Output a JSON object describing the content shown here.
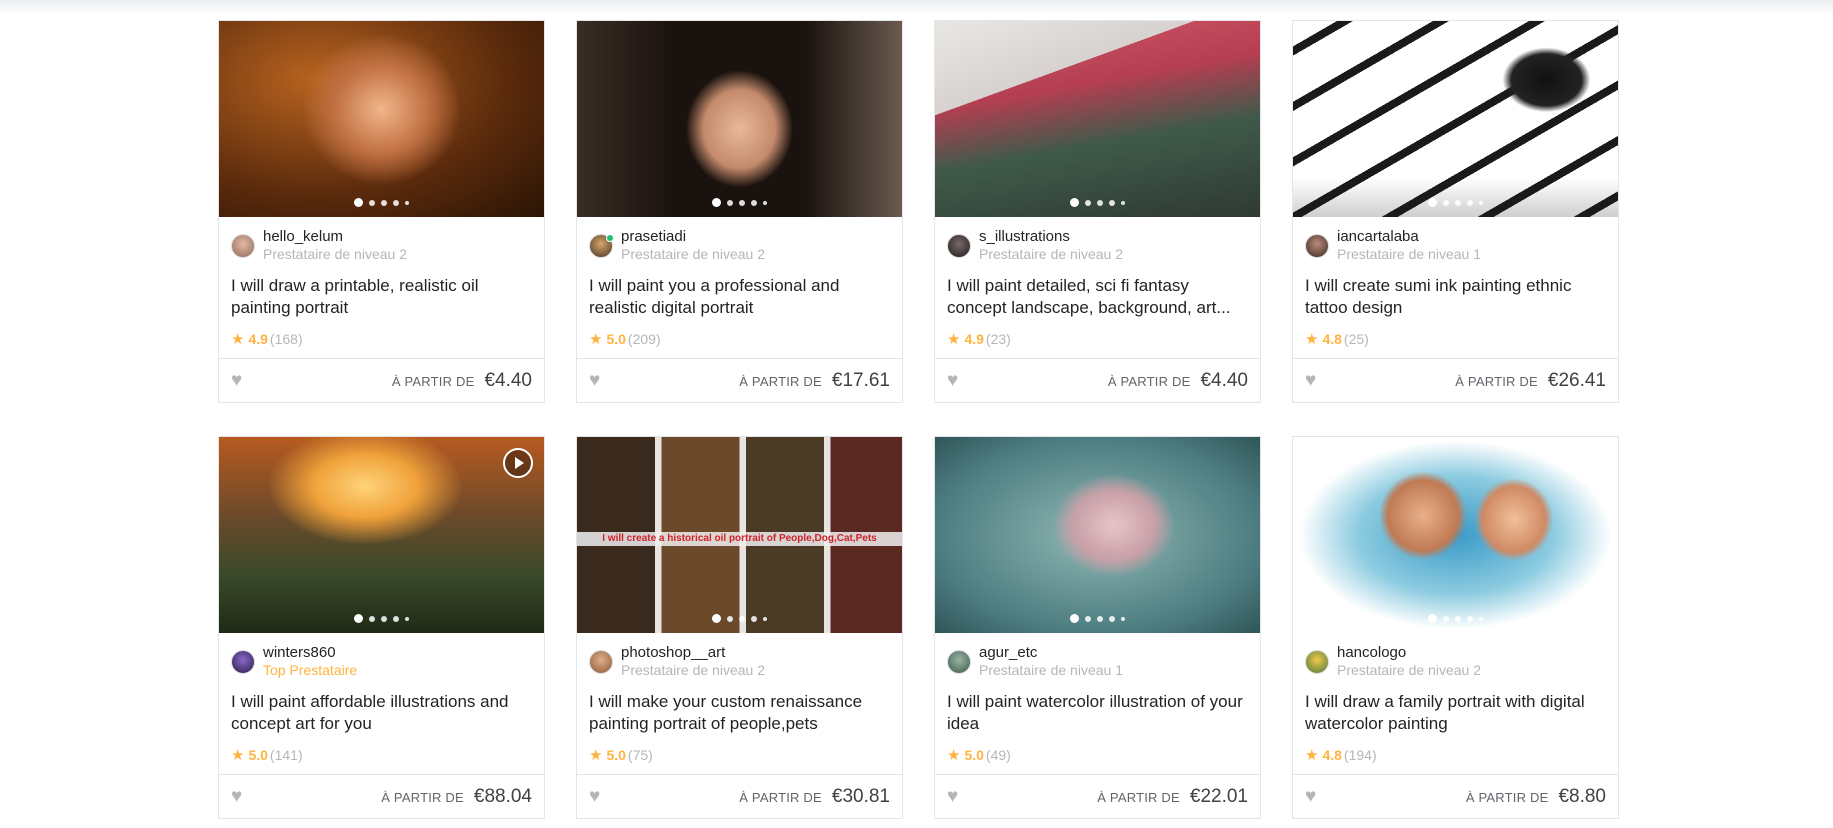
{
  "cards": [
    {
      "seller": "hello_kelum",
      "level": "Prestataire de niveau 2",
      "top": false,
      "title": "I will draw a printable, realistic oil painting portrait",
      "rating": "4.9",
      "count": "(168)",
      "price_label": "À PARTIR DE",
      "price": "€4.40",
      "art": "warm-oil-portrait"
    },
    {
      "seller": "prasetiadi",
      "level": "Prestataire de niveau 2",
      "top": false,
      "title": "I will paint you a professional and realistic digital portrait",
      "rating": "5.0",
      "count": "(209)",
      "price_label": "À PARTIR DE",
      "price": "€17.61",
      "art": "digital-portrait"
    },
    {
      "seller": "s_illustrations",
      "level": "Prestataire de niveau 2",
      "top": false,
      "title": "I will paint detailed, sci fi fantasy concept landscape, background, art...",
      "rating": "4.9",
      "count": "(23)",
      "price_label": "À PARTIR DE",
      "price": "€4.40",
      "art": "dragon-landscape"
    },
    {
      "seller": "iancartalaba",
      "level": "Prestataire de niveau 1",
      "top": false,
      "title": "I will create sumi ink painting ethnic tattoo design",
      "rating": "4.8",
      "count": "(25)",
      "price_label": "À PARTIR DE",
      "price": "€26.41",
      "art": "ink-octopus"
    },
    {
      "seller": "winters860",
      "level": "Top Prestataire",
      "top": true,
      "title": "I will paint affordable illustrations and concept art for you",
      "rating": "5.0",
      "count": "(141)",
      "price_label": "À PARTIR DE",
      "price": "€88.04",
      "art": "garden-couple"
    },
    {
      "seller": "photoshop__art",
      "level": "Prestataire de niveau 2",
      "top": false,
      "title": "I will make your custom renaissance painting portrait of people,pets",
      "rating": "5.0",
      "count": "(75)",
      "price_label": "À PARTIR DE",
      "price": "€30.81",
      "art": "renaissance-collage",
      "banner": "I will create a historical oil portrait of People,Dog,Cat,Pets"
    },
    {
      "seller": "agur_etc",
      "level": "Prestataire de niveau 1",
      "top": false,
      "title": "I will paint watercolor illustration of your idea",
      "rating": "5.0",
      "count": "(49)",
      "price_label": "À PARTIR DE",
      "price": "€22.01",
      "art": "watercolor-sleeper"
    },
    {
      "seller": "hancologo",
      "level": "Prestataire de niveau 2",
      "top": false,
      "title": "I will draw a family portrait with digital watercolor painting",
      "rating": "4.8",
      "count": "(194)",
      "price_label": "À PARTIR DE",
      "price": "€8.80",
      "art": "family-watercolor"
    }
  ]
}
